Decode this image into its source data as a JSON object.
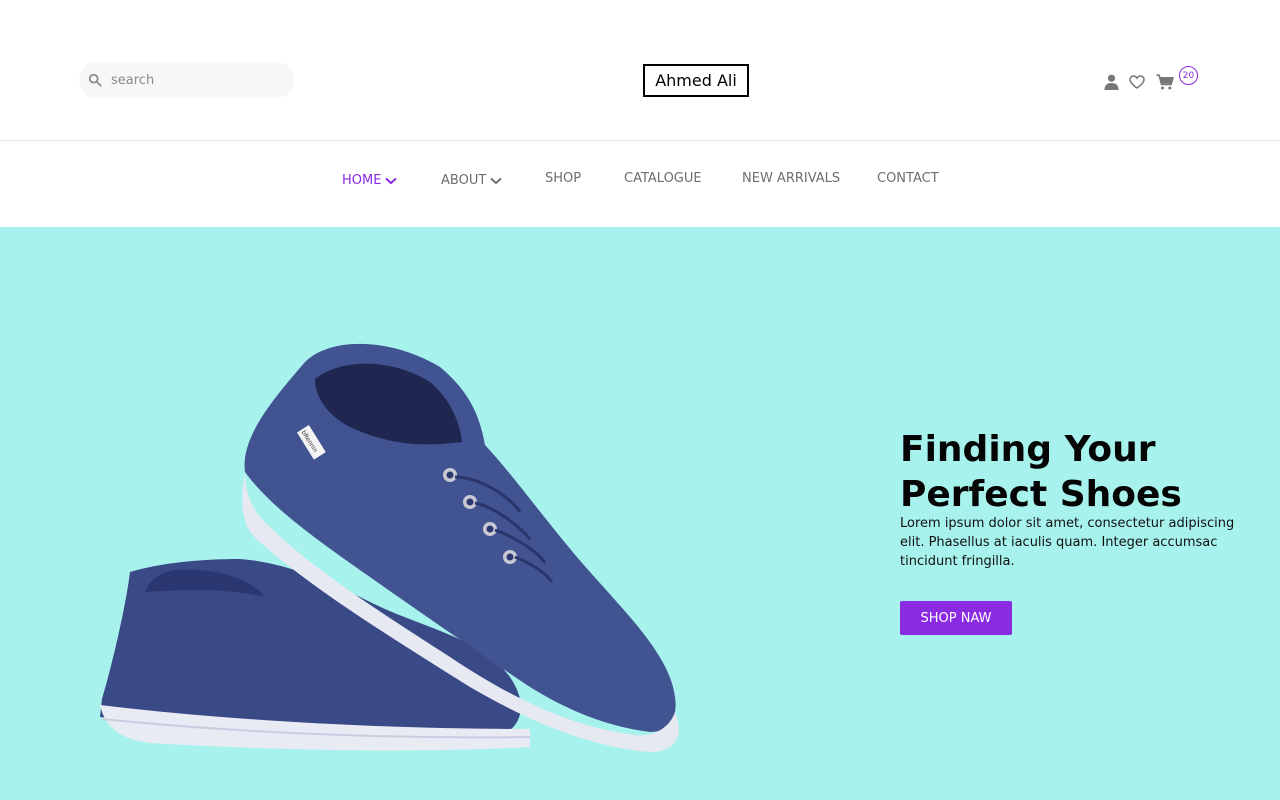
{
  "header": {
    "search": {
      "placeholder": "search",
      "icon": "search-icon"
    },
    "logo": "Ahmed Ali",
    "icons": [
      "user-icon",
      "heart-icon",
      "cart-icon"
    ],
    "cart_count": "20"
  },
  "nav": {
    "items": [
      {
        "label": "HOME",
        "dropdown": true,
        "active": true
      },
      {
        "label": "ABOUT",
        "dropdown": true,
        "active": false
      },
      {
        "label": "SHOP",
        "dropdown": false,
        "active": false
      },
      {
        "label": "CATALOGUE",
        "dropdown": false,
        "active": false
      },
      {
        "label": "NEW ARRIVALS",
        "dropdown": false,
        "active": false
      },
      {
        "label": "CONTACT",
        "dropdown": false,
        "active": false
      }
    ]
  },
  "hero": {
    "title": "Finding Your Perfect Shoes",
    "text": "Lorem ipsum dolor sit amet, consectetur adipiscing elit. Phasellus at iaculis quam. Integer accumsac tincidunt fringilla.",
    "button": "SHOP NAW",
    "shoe_tag": "bRennin"
  },
  "colors": {
    "accent": "#8a2be2",
    "hero_bg": "#a7f2ec",
    "shoe": "#3f4f8c",
    "sole": "#e8eaf2"
  }
}
